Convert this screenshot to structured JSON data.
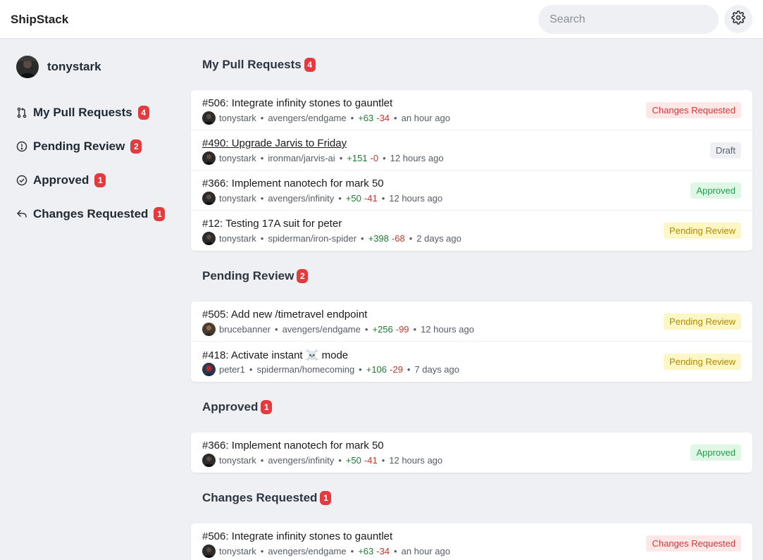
{
  "app": {
    "brand": "ShipStack",
    "search_placeholder": "Search",
    "settings_icon": "gear-icon"
  },
  "user": {
    "name": "tonystark"
  },
  "nav": [
    {
      "label": "My Pull Requests",
      "count": "4",
      "icon": "pull-request-icon"
    },
    {
      "label": "Pending Review",
      "count": "2",
      "icon": "alert-circle-icon"
    },
    {
      "label": "Approved",
      "count": "1",
      "icon": "check-circle-icon"
    },
    {
      "label": "Changes Requested",
      "count": "1",
      "icon": "reply-icon"
    }
  ],
  "colors": {
    "badge": "#e5393d",
    "additions": "#1e7b34",
    "deletions": "#c0392b"
  },
  "sections": [
    {
      "title": "My Pull Requests",
      "count": "4",
      "items": [
        {
          "title": "#506: Integrate infinity stones to gauntlet",
          "author": "tonystark",
          "repo": "avengers/endgame",
          "additions": "+63",
          "deletions": "-34",
          "time": "an hour ago",
          "status": "Changes Requested"
        },
        {
          "title": "#490: Upgrade Jarvis to Friday",
          "author": "tonystark",
          "repo": "ironman/jarvis-ai",
          "additions": "+151",
          "deletions": "-0",
          "time": "12 hours ago",
          "status": "Draft"
        },
        {
          "title": "#366: Implement nanotech for mark 50",
          "author": "tonystark",
          "repo": "avengers/infinity",
          "additions": "+50",
          "deletions": "-41",
          "time": "12 hours ago",
          "status": "Approved"
        },
        {
          "title": "#12: Testing 17A suit for peter",
          "author": "tonystark",
          "repo": "spiderman/iron-spider",
          "additions": "+398",
          "deletions": "-68",
          "time": "2 days ago",
          "status": "Pending Review"
        }
      ]
    },
    {
      "title": "Pending Review",
      "count": "2",
      "items": [
        {
          "title": "#505: Add new /timetravel endpoint",
          "author": "brucebanner",
          "repo": "avengers/endgame",
          "additions": "+256",
          "deletions": "-99",
          "time": "12 hours ago",
          "status": "Pending Review"
        },
        {
          "title": "#418: Activate instant ☠️ mode",
          "author": "peter1",
          "repo": "spiderman/homecoming",
          "additions": "+106",
          "deletions": "-29",
          "time": "7 days ago",
          "status": "Pending Review"
        }
      ]
    },
    {
      "title": "Approved",
      "count": "1",
      "items": [
        {
          "title": "#366: Implement nanotech for mark 50",
          "author": "tonystark",
          "repo": "avengers/infinity",
          "additions": "+50",
          "deletions": "-41",
          "time": "12 hours ago",
          "status": "Approved"
        }
      ]
    },
    {
      "title": "Changes Requested",
      "count": "1",
      "items": [
        {
          "title": "#506: Integrate infinity stones to gauntlet",
          "author": "tonystark",
          "repo": "avengers/endgame",
          "additions": "+63",
          "deletions": "-34",
          "time": "an hour ago",
          "status": "Changes Requested"
        }
      ]
    }
  ]
}
